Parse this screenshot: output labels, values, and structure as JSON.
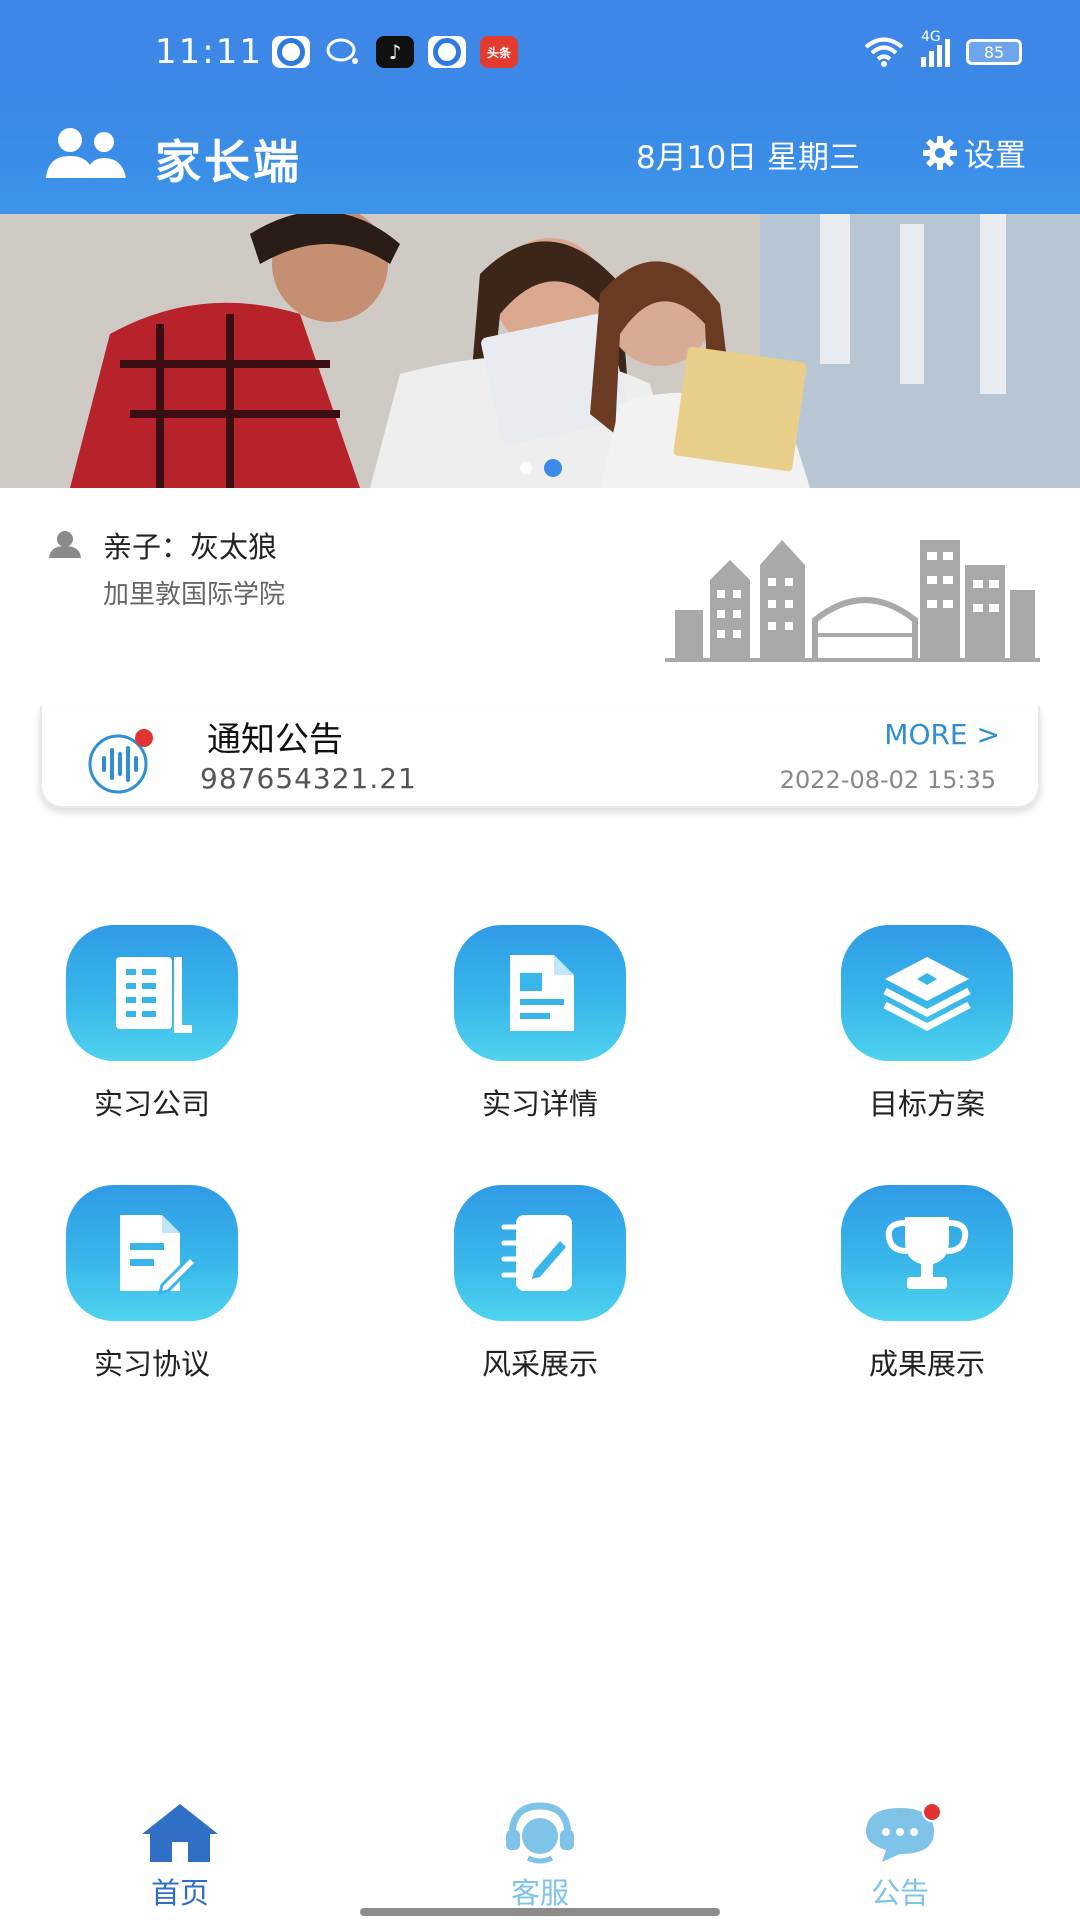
{
  "status_bar": {
    "time": "11:11",
    "network": "4G",
    "battery": "85",
    "notification_icons": [
      "eye-app-icon",
      "chat-icon",
      "tiktok-icon",
      "eye-app-icon",
      "toutiao-icon"
    ],
    "toutiao_text": "头条"
  },
  "header": {
    "title": "家长端",
    "date": "8月10日 星期三",
    "settings_label": "设置",
    "bg_color": "#3a8ae6"
  },
  "banner": {
    "active_slide": 2,
    "slide_count": 2
  },
  "child": {
    "name": "亲子：灰太狼",
    "school": "加里敦国际学院"
  },
  "notice": {
    "title": "通知公告",
    "more": "MORE >",
    "snippet": "987654321.21",
    "time": "2022-08-02 15:35",
    "has_unread": true
  },
  "menu": [
    {
      "label": "实习公司",
      "icon": "company-icon"
    },
    {
      "label": "实习详情",
      "icon": "document-icon"
    },
    {
      "label": "目标方案",
      "icon": "layers-icon"
    },
    {
      "label": "实习协议",
      "icon": "agreement-icon"
    },
    {
      "label": "风采展示",
      "icon": "notebook-icon"
    },
    {
      "label": "成果展示",
      "icon": "trophy-icon"
    }
  ],
  "bottom_nav": [
    {
      "label": "首页",
      "icon": "home-icon",
      "active": true
    },
    {
      "label": "客服",
      "icon": "customer-service-icon",
      "active": false
    },
    {
      "label": "公告",
      "icon": "message-icon",
      "active": false,
      "has_badge": true
    }
  ],
  "colors": {
    "accent": "#3a8ae6",
    "tile": "#38b6ea",
    "nav_active": "#2f6fc6",
    "nav_inactive": "#7fc3e8",
    "badge": "#e03434"
  }
}
